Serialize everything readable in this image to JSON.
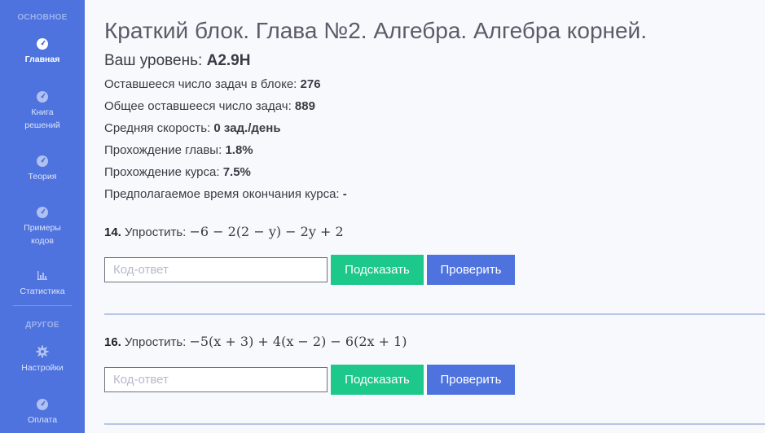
{
  "sidebar": {
    "heading_main": "ОСНОВНОЕ",
    "heading_other": "ДРУГОЕ",
    "items": [
      {
        "label": "Главная",
        "icon": "dashboard-icon",
        "active": true
      },
      {
        "label": "Книга решений",
        "icon": "dashboard-icon"
      },
      {
        "label": "Теория",
        "icon": "dashboard-icon"
      },
      {
        "label": "Примеры кодов",
        "icon": "dashboard-icon"
      },
      {
        "label": "Статистика",
        "icon": "chart-icon"
      },
      {
        "label": "Настройки",
        "icon": "gear-icon"
      },
      {
        "label": "Оплата",
        "icon": "dashboard-icon"
      }
    ]
  },
  "main": {
    "title": "Краткий блок. Глава №2. Алгебра. Алгебра корней.",
    "level_label": "Ваш уровень:",
    "level_value": "A2.9H",
    "stats": [
      {
        "label": "Оставшееся число задач в блоке:",
        "value": "276"
      },
      {
        "label": "Общее оставшееся число задач:",
        "value": "889"
      },
      {
        "label": "Средняя скорость:",
        "value": "0 зад./день"
      },
      {
        "label": "Прохождение главы:",
        "value": "1.8%"
      },
      {
        "label": "Прохождение курса:",
        "value": "7.5%"
      },
      {
        "label": "Предполагаемое время окончания курса:",
        "value": "-"
      }
    ],
    "tasks": [
      {
        "number": "14.",
        "prompt": "Упростить:",
        "expression": "−6 − 2(2 − y) − 2y + 2",
        "placeholder": "Код-ответ",
        "hint_label": "Подсказать",
        "check_label": "Проверить"
      },
      {
        "number": "16.",
        "prompt": "Упростить:",
        "expression": "−5(x + 3) + 4(x − 2) − 6(2x + 1)",
        "placeholder": "Код-ответ",
        "hint_label": "Подсказать",
        "check_label": "Проверить"
      }
    ]
  },
  "colors": {
    "sidebar": "#4e73df",
    "hint_button": "#1cc88a",
    "check_button": "#4e73df",
    "background": "#f8f9fc"
  }
}
